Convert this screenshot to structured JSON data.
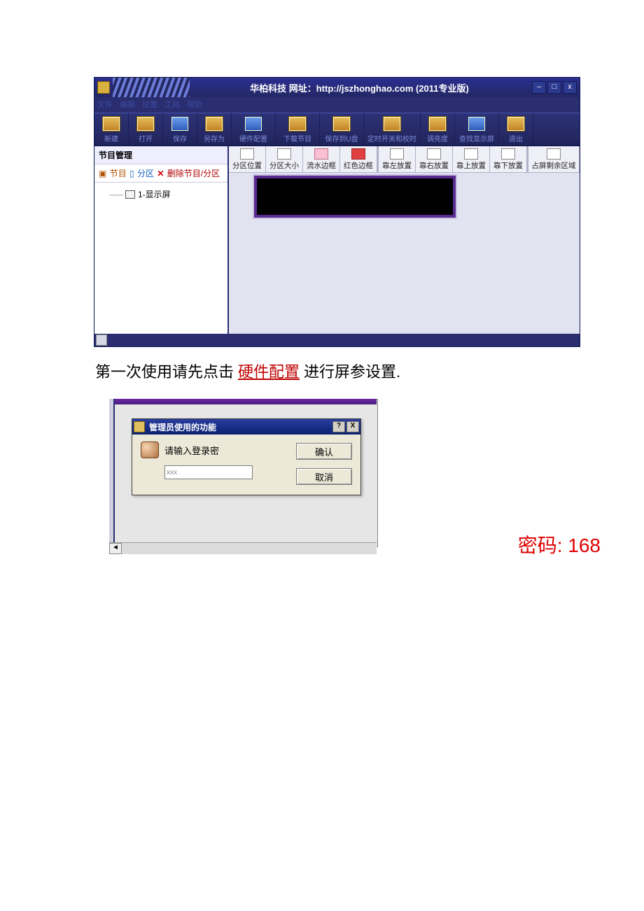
{
  "window": {
    "title": "华柏科技 网址：http://jszhonghao.com (2011专业版)",
    "controls": {
      "min": "–",
      "max": "□",
      "close": "x"
    }
  },
  "menubar": [
    "文件",
    "编辑",
    "设置",
    "工具",
    "帮助"
  ],
  "main_toolbar": [
    {
      "label": "新建"
    },
    {
      "label": "打开"
    },
    {
      "label": "保存"
    },
    {
      "label": "另存为"
    },
    {
      "label": "硬件配置"
    },
    {
      "label": "下载节目"
    },
    {
      "label": "保存到U盘"
    },
    {
      "label": "定时开关和校时"
    },
    {
      "label": "调亮度"
    },
    {
      "label": "查找显示屏"
    },
    {
      "label": "退出"
    }
  ],
  "sidebar": {
    "title": "节目管理",
    "tabs": {
      "prog_icon": "▣",
      "prog": "节目",
      "zone_icon": "▯",
      "zone": "分区",
      "del_x": "✕",
      "del": "删除节目/分区"
    },
    "tree_node": "1-显示屏"
  },
  "sub_toolbar": [
    "分区位置",
    "分区大小",
    "流水边框",
    "红色边框",
    "靠左放置",
    "靠右放置",
    "靠上放置",
    "靠下放置",
    "占屏剩余区域"
  ],
  "instruction": {
    "pre": "第一次使用请先点击",
    "highlight": "硬件配置",
    "post": "进行屏参设置."
  },
  "dialog": {
    "title": "管理员使用的功能",
    "help": "?",
    "close": "X",
    "prompt": "请输入登录密",
    "input_value": "xxx",
    "ok": "确认",
    "cancel": "取消"
  },
  "password_note": "密码: 168"
}
